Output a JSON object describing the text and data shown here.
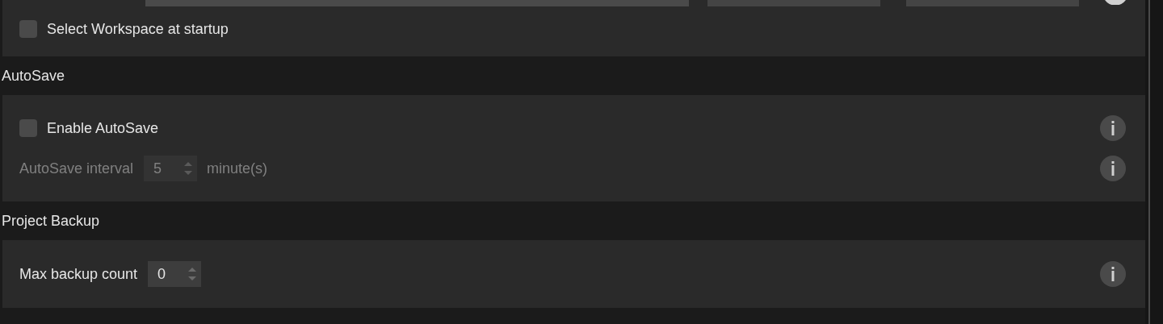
{
  "top_panel": {
    "fields": [
      {
        "kind": "path"
      },
      {
        "kind": "button"
      },
      {
        "kind": "button"
      }
    ],
    "checkbox": {
      "label": "Select Workspace at startup",
      "checked": false
    }
  },
  "sections": [
    {
      "title": "AutoSave",
      "rows": [
        {
          "kind": "checkbox",
          "label": "Enable AutoSave",
          "checked": false,
          "disabled": false
        },
        {
          "kind": "spinbox",
          "label": "AutoSave interval",
          "value": "5",
          "suffix": "minute(s)",
          "disabled": true
        }
      ]
    },
    {
      "title": "Project Backup",
      "rows": [
        {
          "kind": "spinbox",
          "label": "Max backup count",
          "value": "0",
          "disabled": false
        }
      ]
    }
  ]
}
